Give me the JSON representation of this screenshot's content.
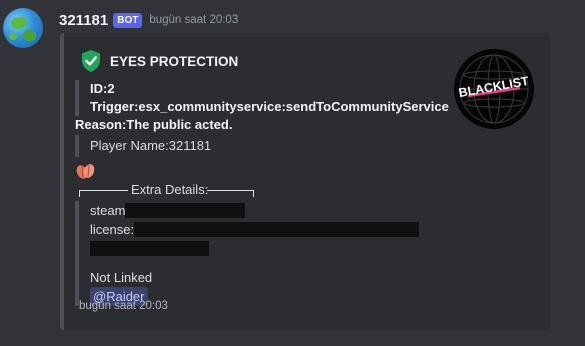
{
  "message": {
    "username": "321181",
    "bot_tag": "BOT",
    "timestamp": "bugün saat 20:03"
  },
  "embed": {
    "author": "EYES PROTECTION",
    "fields": {
      "id": "ID:2",
      "trigger": "Trigger:esx_communityservice:sendToCommunityService",
      "reason": "Reason:The public acted.",
      "player": "Player Name:321181"
    },
    "thumbnail_text": "BLACKLIST",
    "extra_title": "Extra Details:",
    "extra": {
      "steam": "steam",
      "license": "license:",
      "not_linked": "Not Linked",
      "mention": "@Raider"
    },
    "footer": "bugün saat 20:03"
  },
  "colors": {
    "background": "#313338",
    "embed_bg": "#2b2d31",
    "bot_tag": "#5865f2",
    "shield": "#23a55a",
    "mention_bg": "#3c4270"
  },
  "icons": [
    "globe-avatar",
    "check-shield-icon",
    "blacklist-logo",
    "leaf-emoji"
  ]
}
